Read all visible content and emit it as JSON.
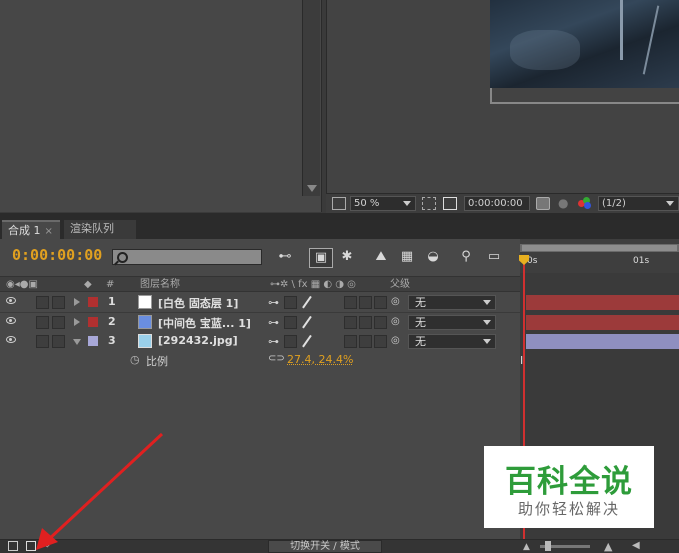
{
  "tabs": {
    "composition": "合成 1",
    "close_glyph": "×",
    "render_queue": "渲染队列"
  },
  "viewer": {
    "zoom": "50 %",
    "timecode": "0:00:00:00",
    "resolution": "(1/2)"
  },
  "timeline": {
    "current_time": "0:00:00:00",
    "search_placeholder": "",
    "columns": {
      "number": "#",
      "layer_name": "图层名称",
      "parent": "父级"
    },
    "layers": [
      {
        "num": "1",
        "name": "[白色 固态层 1]",
        "label_color": "#b03030",
        "thumb_color": "#ffffff",
        "parent": "无",
        "track_color": "#9c3a3a"
      },
      {
        "num": "2",
        "name": "[中间色 宝蓝... 1]",
        "label_color": "#b03030",
        "thumb_color": "#6a8ee0",
        "parent": "无",
        "track_color": "#9c3a3a"
      },
      {
        "num": "3",
        "name": "[292432.jpg]",
        "label_color": "#a8a8d8",
        "thumb_color": "#9ad0ea",
        "parent": "无",
        "track_color": "#8f8fc0"
      }
    ],
    "property": {
      "name": "比例",
      "value": "27.4, 24.4%"
    },
    "ruler": {
      "start": "0s",
      "mark": "01s"
    }
  },
  "footer": {
    "switch_label": "切换开关 / 模式"
  },
  "watermark": {
    "title": "百科全说",
    "subtitle": "助你轻松解决"
  },
  "colors": {
    "accent_timecode": "#e0a020",
    "watermark_green": "#2e9c3a",
    "arrow_red": "#e02020"
  }
}
